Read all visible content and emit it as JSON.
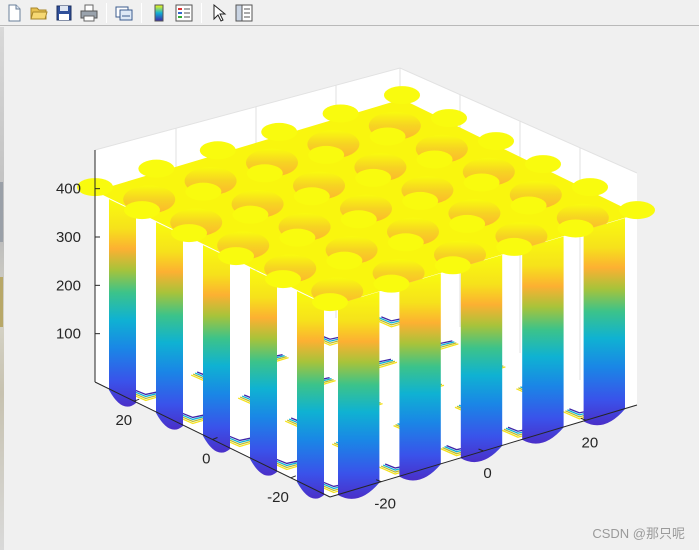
{
  "toolbar": {
    "items": [
      {
        "name": "new-figure-button",
        "icon": "new-file-icon"
      },
      {
        "name": "open-file-button",
        "icon": "folder-open-icon"
      },
      {
        "name": "save-figure-button",
        "icon": "save-disk-icon"
      },
      {
        "name": "print-figure-button",
        "icon": "printer-icon"
      },
      {
        "name": "link-plot-button",
        "icon": "link-plot-icon"
      },
      {
        "name": "insert-colorbar-button",
        "icon": "colorbar-icon"
      },
      {
        "name": "insert-legend-button",
        "icon": "legend-icon"
      },
      {
        "name": "edit-plot-button",
        "icon": "pointer-arrow-icon"
      },
      {
        "name": "property-inspector-button",
        "icon": "property-panel-icon"
      }
    ]
  },
  "chart_data": {
    "type": "surface",
    "z_ticks": [
      "100",
      "200",
      "300",
      "400"
    ],
    "x_ticks": [
      "-20",
      "0",
      "20"
    ],
    "y_ticks": [
      "20",
      "0",
      "-20"
    ],
    "zlim": [
      0,
      480
    ],
    "xlim": [
      -30,
      30
    ],
    "ylim": [
      -30,
      30
    ],
    "grid": true,
    "colormap": [
      "#3e26a8",
      "#2f6ff0",
      "#10b0d6",
      "#3bc383",
      "#bcbc30",
      "#fdbb2d",
      "#f9fb0e"
    ],
    "contour_on_floor": true
  },
  "watermark": "CSDN @那只呢"
}
